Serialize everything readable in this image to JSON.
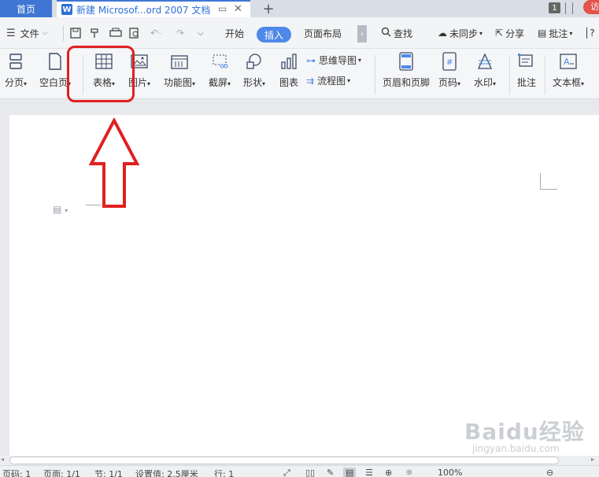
{
  "tabbar": {
    "home": "首页",
    "doc_title": "新建 Microsof...ord 2007 文档",
    "doc_logo": "W",
    "badge": "1",
    "visit": "访"
  },
  "menu": {
    "file": "文件",
    "start": "开始",
    "insert": "插入",
    "layout": "页面布局",
    "search": "查找",
    "sync": "未同步",
    "share": "分享",
    "comment": "批注"
  },
  "ribbon": {
    "page_break": "分页",
    "blank_page": "空白页",
    "table": "表格",
    "picture": "图片",
    "function_chart": "功能图",
    "screenshot": "截屏",
    "shape": "形状",
    "chart": "图表",
    "mind_map": "思维导图",
    "flow_chart": "流程图",
    "header_footer": "页眉和页脚",
    "page_number": "页码",
    "watermark": "水印",
    "annotation": "批注",
    "text_box": "文本框"
  },
  "status": {
    "page": "页码: 1",
    "pages": "页面: 1/1",
    "section": "节: 1/1",
    "position": "设置值: 2.5厘米",
    "row": "行: 1",
    "zoom": "100%"
  },
  "watermark": {
    "brand": "Baidu经验",
    "url": "jingyan.baidu.com"
  },
  "colors": {
    "accent": "#4e89e8",
    "home_tab": "#3f76d3",
    "annotation": "#e02020"
  }
}
